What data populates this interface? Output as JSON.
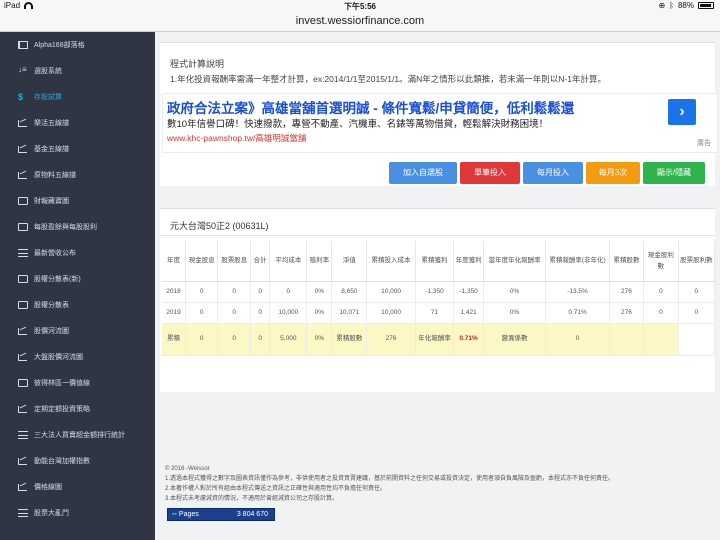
{
  "status_bar": {
    "device": "iPad",
    "time": "下午5:56",
    "battery": "88%"
  },
  "url": "invest.wessiorfinance.com",
  "sidebar": {
    "items": [
      {
        "label": "Alpha168部落格",
        "icon": "book-icon",
        "active": false
      },
      {
        "label": "選股系統",
        "icon": "sort-icon",
        "active": false
      },
      {
        "label": "存股試算",
        "icon": "dollar-icon",
        "active": true
      },
      {
        "label": "樂活五線譜",
        "icon": "chart-icon",
        "active": false
      },
      {
        "label": "基金五線譜",
        "icon": "chart-icon",
        "active": false
      },
      {
        "label": "原物料五線譜",
        "icon": "chart-icon",
        "active": false
      },
      {
        "label": "財報藏寶圖",
        "icon": "folder-icon",
        "active": false
      },
      {
        "label": "每股盈餘與每股股利",
        "icon": "folder-icon",
        "active": false
      },
      {
        "label": "最新營收公布",
        "icon": "list-icon",
        "active": false
      },
      {
        "label": "股權分散表(新)",
        "icon": "folder-icon",
        "active": false
      },
      {
        "label": "股權分散表",
        "icon": "folder-icon",
        "active": false
      },
      {
        "label": "股價河流圖",
        "icon": "chart-icon",
        "active": false
      },
      {
        "label": "大盤股價河流圖",
        "icon": "chart-icon",
        "active": false
      },
      {
        "label": "彼得林區一價值線",
        "icon": "folder-icon",
        "active": false
      },
      {
        "label": "定期定額投資策略",
        "icon": "chart-icon",
        "active": false
      },
      {
        "label": "三大法人買賣超金額排行統計",
        "icon": "list-icon",
        "active": false
      },
      {
        "label": "動能台灣加權指數",
        "icon": "chart-icon",
        "active": false
      },
      {
        "label": "價格線圖",
        "icon": "chart-icon",
        "active": false
      },
      {
        "label": "股票大亂鬥",
        "icon": "list-icon",
        "active": false
      }
    ]
  },
  "info": {
    "title": "程式計算說明",
    "text": "1.年化投資報酬率需滿一年整才計算，ex:2014/1/1至2015/1/1。滿N年之情形以此類推，若未滿一年則以N-1年計算。"
  },
  "ad": {
    "title": "政府合法立案》高雄當舖首選明誠 - 條件寬鬆/申貸簡便，低利鬆鬆還",
    "desc": "數10年信譽口碑！快速撥款，專營不動產、汽機車、名錶等萬物借貸，輕鬆解決財務困境！",
    "url": "www.khc-pawnshop.tw/高雄明誠當舖",
    "button": "›",
    "label": "廣告"
  },
  "buttons": [
    {
      "label": "加入自選股",
      "color": "#4a90e2"
    },
    {
      "label": "單筆投入",
      "color": "#e0373a"
    },
    {
      "label": "每月投入",
      "color": "#4a90e2"
    },
    {
      "label": "每月3次",
      "color": "#f39c12"
    },
    {
      "label": "顯示/隱藏",
      "color": "#2fb44c"
    }
  ],
  "table": {
    "title": "元大台灣50正2 (00631L)",
    "headers": [
      "年度",
      "現金股息",
      "股票股息",
      "合計",
      "平均成本",
      "殖利率",
      "淨值",
      "累積投入成本",
      "累積獲利",
      "年度獲利",
      "當年度年化報酬率",
      "累積報酬率(非年化)",
      "累積股數",
      "現金股利數",
      "股票股利數"
    ],
    "rows": [
      [
        "2018",
        "0",
        "0",
        "0",
        "0",
        "0%",
        "8,650",
        "10,000",
        "-1,350",
        "-1,350",
        "0%",
        "-13.5%",
        "276",
        "0",
        "0"
      ],
      [
        "2019",
        "0",
        "0",
        "0",
        "10,000",
        "0%",
        "10,071",
        "10,000",
        "71",
        "1,421",
        "0%",
        "0.71%",
        "276",
        "0",
        "0"
      ]
    ],
    "summary": [
      "累積",
      "0",
      "0",
      "0",
      "5,000",
      "0%",
      "累積股數",
      "276",
      "年化報酬率",
      "0.71%",
      "變異係數",
      "0",
      "",
      "",
      ""
    ]
  },
  "footer": {
    "copyright": "© 2016 -Weissor",
    "lines": [
      "1.透過本程式獲得之數字及圖表資訊僅作為參考，非供使用者之投資買賣建議，基於前開資料之任何交易或投資決定，使用者須自負風險及盈虧，本程式亦不負任何責任。",
      "2.本著作權人對於所有經由本程式傳送之資訊之正確性與適用性均不負擔任何責任。",
      "3.本程式未考慮減資的情況，不適用於曾經減資公司之存股計算。"
    ]
  },
  "counter": {
    "label": "Pages",
    "value": "3 804 670"
  }
}
